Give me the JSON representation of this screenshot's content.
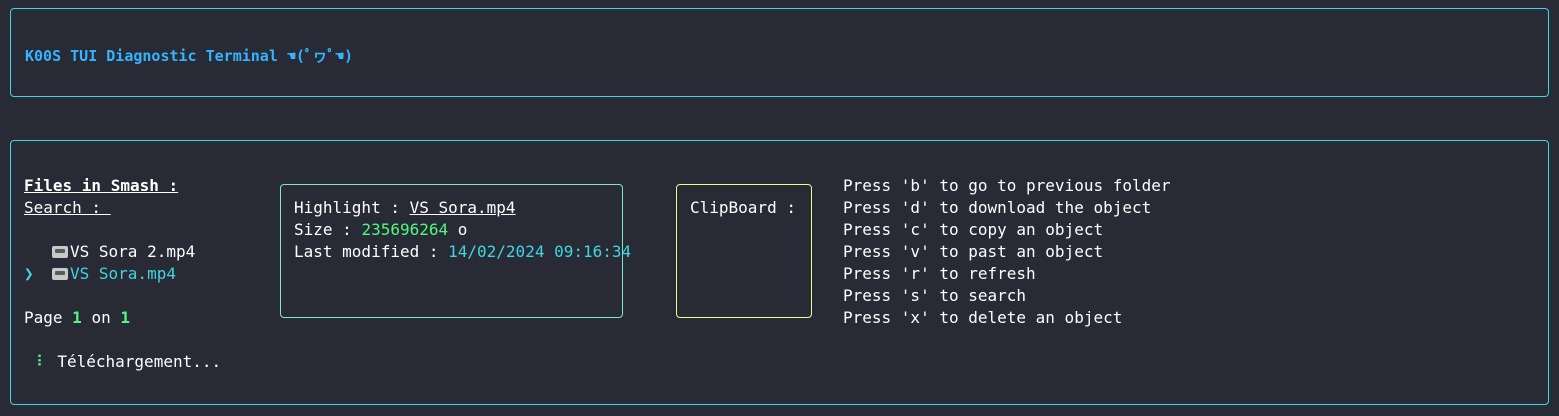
{
  "header": {
    "title": "K00S TUI Diagnostic Terminal ☚(ﾟヮﾟ☚)"
  },
  "browser": {
    "title": "Files in Smash :",
    "search_label": "Search : ",
    "files": [
      {
        "name": "VS Sora 2.mp4",
        "selected": false
      },
      {
        "name": "VS Sora.mp4",
        "selected": true
      }
    ],
    "cursor": "❯",
    "page_prefix": "Page ",
    "page_current": "1",
    "page_mid": " on ",
    "page_total": "1",
    "spinner": "⠇",
    "status": "Téléchargement..."
  },
  "details": {
    "highlight_label": "Highlight : ",
    "highlight_value": "VS Sora.mp4",
    "size_label": "Size : ",
    "size_value": "235696264",
    "size_unit": " o",
    "modified_label": "Last modified : ",
    "modified_value": "14/02/2024 09:16:34"
  },
  "clipboard": {
    "label": "ClipBoard :"
  },
  "help": [
    "Press 'b' to go to previous folder",
    "Press 'd' to download the object",
    "Press 'c' to copy an object",
    "Press 'v' to past an object",
    "Press 'r' to refresh",
    "Press 's' to search",
    "Press 'x' to delete an object"
  ],
  "colors": {
    "background": "#282a36",
    "border": "#3fd6e0",
    "title": "#33b5ff",
    "value_green": "#50fa7b",
    "value_cyan": "#3fd6e0",
    "details_border": "#7ee8c7",
    "clipboard_border": "#f1fa8c"
  }
}
